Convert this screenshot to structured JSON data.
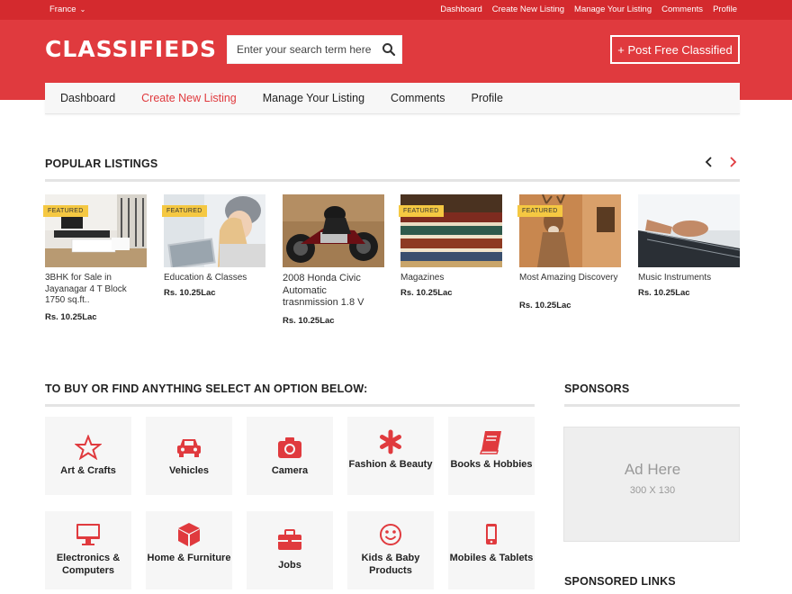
{
  "topbar": {
    "country": "France",
    "links": [
      "Dashboard",
      "Create New Listing",
      "Manage Your Listing",
      "Comments",
      "Profile"
    ]
  },
  "header": {
    "logo": "CLASSIFIEDS",
    "search_placeholder": "Enter your search term here",
    "post_button": "+ Post Free Classified"
  },
  "nav": {
    "items": [
      "Dashboard",
      "Create New Listing",
      "Manage Your Listing",
      "Comments",
      "Profile"
    ],
    "active": "Create New Listing"
  },
  "popular": {
    "title": "POPULAR LISTINGS",
    "items": [
      {
        "title": "3BHK for Sale in Jayanagar 4 T Block 1750 sq.ft..",
        "price": "Rs. 10.25Lac",
        "featured": "FEATURED"
      },
      {
        "title": "Education & Classes",
        "price": "Rs. 10.25Lac",
        "featured": "FEATURED"
      },
      {
        "title": "2008 Honda Civic Automatic trasnmission 1.8 V",
        "price": "Rs. 10.25Lac",
        "featured": ""
      },
      {
        "title": "Magazines",
        "price": "Rs. 10.25Lac",
        "featured": "FEATURED"
      },
      {
        "title": "Most Amazing Discovery",
        "price": "Rs. 10.25Lac",
        "featured": "FEATURED"
      },
      {
        "title": "Music Instruments",
        "price": "Rs. 10.25Lac",
        "featured": ""
      }
    ]
  },
  "categories": {
    "title": "TO BUY OR FIND ANYTHING SELECT AN OPTION BELOW:",
    "items": [
      {
        "label": "Art & Crafts",
        "icon": "star-icon"
      },
      {
        "label": "Vehicles",
        "icon": "car-icon"
      },
      {
        "label": "Camera",
        "icon": "camera-icon"
      },
      {
        "label": "Fashion & Beauty",
        "icon": "asterisk-icon"
      },
      {
        "label": "Books & Hobbies",
        "icon": "book-icon"
      },
      {
        "label": "Electronics & Computers",
        "icon": "monitor-icon"
      },
      {
        "label": "Home & Furniture",
        "icon": "cube-icon"
      },
      {
        "label": "Jobs",
        "icon": "briefcase-icon"
      },
      {
        "label": "Kids & Baby Products",
        "icon": "smiley-icon"
      },
      {
        "label": "Mobiles & Tablets",
        "icon": "mobile-icon"
      }
    ]
  },
  "sponsors": {
    "title": "SPONSORS",
    "ad_title": "Ad Here",
    "ad_size": "300 X 130",
    "links_title": "SPONSORED LINKS"
  },
  "colors": {
    "brand_red": "#e03a3e",
    "topbar_red": "#d42a2e",
    "featured_yellow": "#f5c842"
  }
}
